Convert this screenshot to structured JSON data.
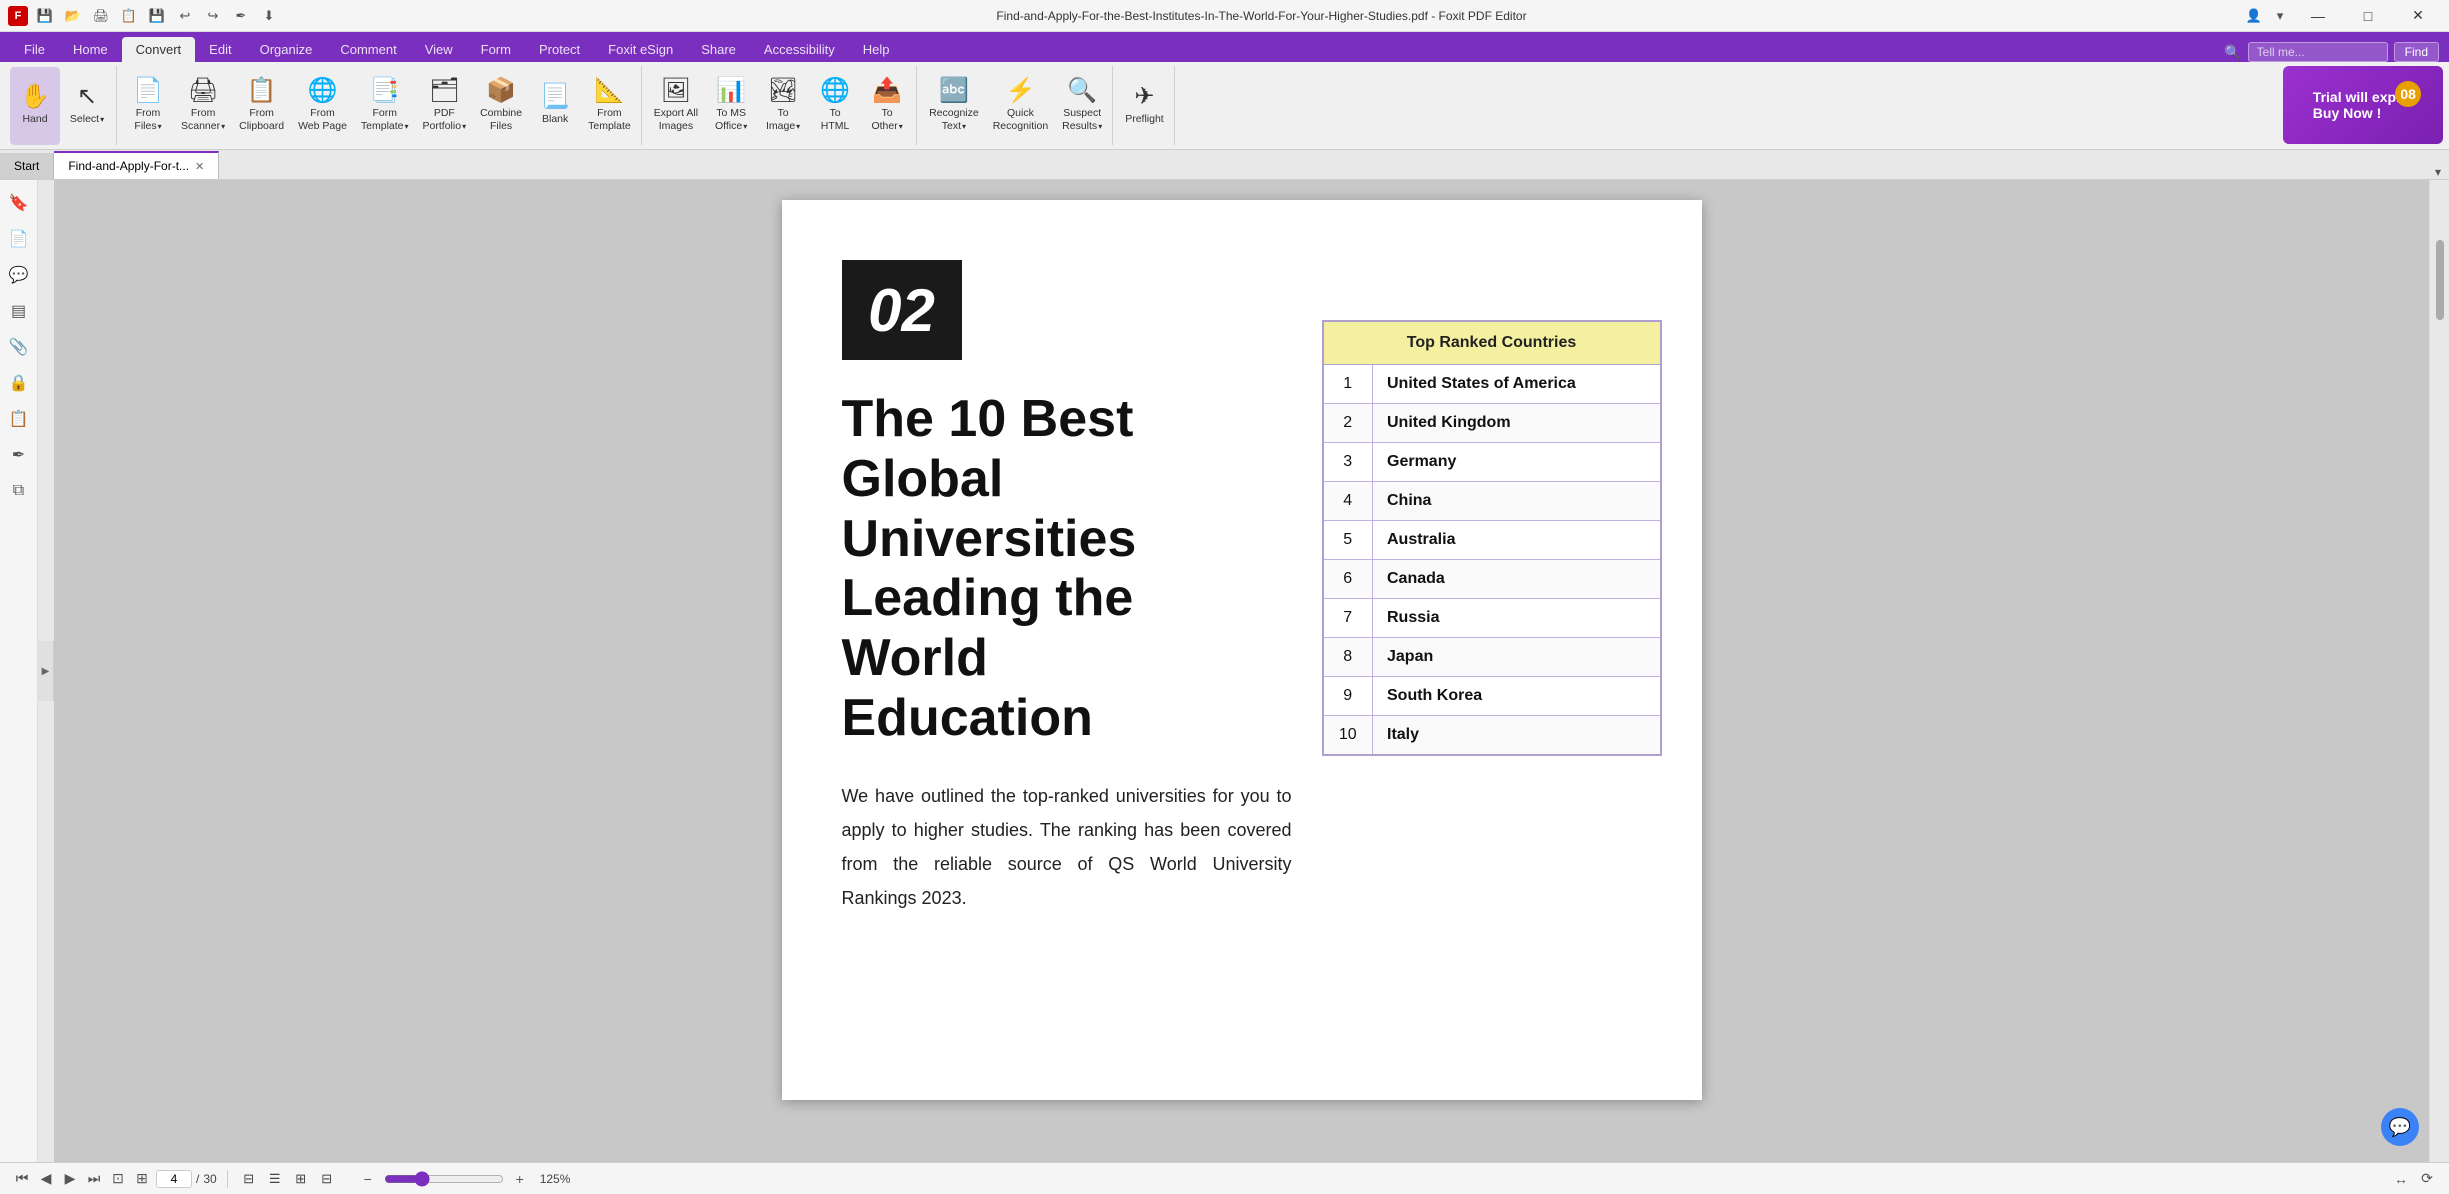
{
  "titlebar": {
    "title": "Find-and-Apply-For-the-Best-Institutes-In-The-World-For-Your-Higher-Studies.pdf - Foxit PDF Editor",
    "app_icon": "F",
    "buttons": {
      "minimize": "—",
      "maximize": "□",
      "close": "✕"
    },
    "quick_access": [
      "💾",
      "🖨",
      "↩",
      "↪"
    ]
  },
  "ribbon_tabs": [
    {
      "label": "File",
      "active": false
    },
    {
      "label": "Home",
      "active": false
    },
    {
      "label": "Convert",
      "active": true
    },
    {
      "label": "Edit",
      "active": false
    },
    {
      "label": "Organize",
      "active": false
    },
    {
      "label": "Comment",
      "active": false
    },
    {
      "label": "View",
      "active": false
    },
    {
      "label": "Form",
      "active": false
    },
    {
      "label": "Protect",
      "active": false
    },
    {
      "label": "Foxit eSign",
      "active": false
    },
    {
      "label": "Share",
      "active": false
    },
    {
      "label": "Accessibility",
      "active": false
    },
    {
      "label": "Help",
      "active": false
    }
  ],
  "search": {
    "placeholder": "Tell me..."
  },
  "toolbar": {
    "buttons": [
      {
        "id": "hand",
        "icon": "✋",
        "label": "Hand",
        "active": true,
        "has_dropdown": false
      },
      {
        "id": "select",
        "icon": "↖",
        "label": "Select",
        "active": false,
        "has_dropdown": true
      },
      {
        "id": "from-files",
        "icon": "📄",
        "label": "From\nFiles",
        "active": false,
        "has_dropdown": true
      },
      {
        "id": "from-scanner",
        "icon": "🖨",
        "label": "From\nScanner",
        "active": false,
        "has_dropdown": true
      },
      {
        "id": "from-clipboard",
        "icon": "📋",
        "label": "From\nClipboard",
        "active": false,
        "has_dropdown": false
      },
      {
        "id": "from-web-page",
        "icon": "🌐",
        "label": "From\nWeb Page",
        "active": false,
        "has_dropdown": false
      },
      {
        "id": "form-template",
        "icon": "📑",
        "label": "Form\nTemplate",
        "active": false,
        "has_dropdown": true
      },
      {
        "id": "pdf-portfolio",
        "icon": "🗂",
        "label": "PDF\nPortfolio",
        "active": false,
        "has_dropdown": true
      },
      {
        "id": "combine-files",
        "icon": "📦",
        "label": "Combine\nFiles",
        "active": false,
        "has_dropdown": false
      },
      {
        "id": "blank",
        "icon": "📃",
        "label": "Blank",
        "active": false,
        "has_dropdown": false
      },
      {
        "id": "from-template",
        "icon": "📐",
        "label": "From\nTemplate",
        "active": false,
        "has_dropdown": false
      },
      {
        "id": "export-all-images",
        "icon": "🖼",
        "label": "Export All\nImages",
        "active": false,
        "has_dropdown": false
      },
      {
        "id": "to-ms-office",
        "icon": "📊",
        "label": "To MS\nOffice",
        "active": false,
        "has_dropdown": true
      },
      {
        "id": "to-image",
        "icon": "🏞",
        "label": "To\nImage",
        "active": false,
        "has_dropdown": true
      },
      {
        "id": "to-html",
        "icon": "🌐",
        "label": "To\nHTML",
        "active": false,
        "has_dropdown": false
      },
      {
        "id": "to-other",
        "icon": "📤",
        "label": "To\nOther",
        "active": false,
        "has_dropdown": true
      },
      {
        "id": "recognize-text",
        "icon": "🔤",
        "label": "Recognize\nText",
        "active": false,
        "has_dropdown": true
      },
      {
        "id": "quick-recognition",
        "icon": "⚡",
        "label": "Quick\nRecognition",
        "active": false,
        "has_dropdown": false
      },
      {
        "id": "suspect-results",
        "icon": "🔍",
        "label": "Suspect\nResults",
        "active": false,
        "has_dropdown": true
      },
      {
        "id": "preflight",
        "icon": "✈",
        "label": "Preflight",
        "active": false,
        "has_dropdown": false
      }
    ],
    "trial": {
      "line1": "Trial will expire",
      "line2": "Buy Now !",
      "badge": "08"
    }
  },
  "doc_tabs": [
    {
      "label": "Start",
      "active": false,
      "closable": false
    },
    {
      "label": "Find-and-Apply-For-t...",
      "active": true,
      "closable": true
    }
  ],
  "sidebar_icons": [
    {
      "id": "bookmark",
      "icon": "🔖"
    },
    {
      "id": "pages",
      "icon": "📄"
    },
    {
      "id": "comment",
      "icon": "💬"
    },
    {
      "id": "layers",
      "icon": "▤"
    },
    {
      "id": "attachments",
      "icon": "📎"
    },
    {
      "id": "security",
      "icon": "🔒"
    },
    {
      "id": "output",
      "icon": "📋"
    },
    {
      "id": "signature",
      "icon": "✒"
    },
    {
      "id": "copy",
      "icon": "⧉"
    }
  ],
  "pdf": {
    "page_number": "02",
    "title": "The 10 Best\nGlobal Universities\nLeading the World\nEducation",
    "body": "We have outlined the top-ranked universities for you to apply to higher studies. The ranking has been covered from the reliable source of QS World University Rankings 2023.",
    "table": {
      "header": "Top Ranked Countries",
      "rows": [
        {
          "rank": "1",
          "country": "United States of America"
        },
        {
          "rank": "2",
          "country": "United Kingdom"
        },
        {
          "rank": "3",
          "country": "Germany"
        },
        {
          "rank": "4",
          "country": "China"
        },
        {
          "rank": "5",
          "country": "Australia"
        },
        {
          "rank": "6",
          "country": "Canada"
        },
        {
          "rank": "7",
          "country": "Russia"
        },
        {
          "rank": "8",
          "country": "Japan"
        },
        {
          "rank": "9",
          "country": "South Korea"
        },
        {
          "rank": "10",
          "country": "Italy"
        }
      ]
    }
  },
  "status_bar": {
    "page_current": "4",
    "page_total": "30",
    "zoom": "125%",
    "zoom_value": 125
  },
  "colors": {
    "accent": "#7b2fbe",
    "tab_active_border": "#7b2fbe"
  }
}
